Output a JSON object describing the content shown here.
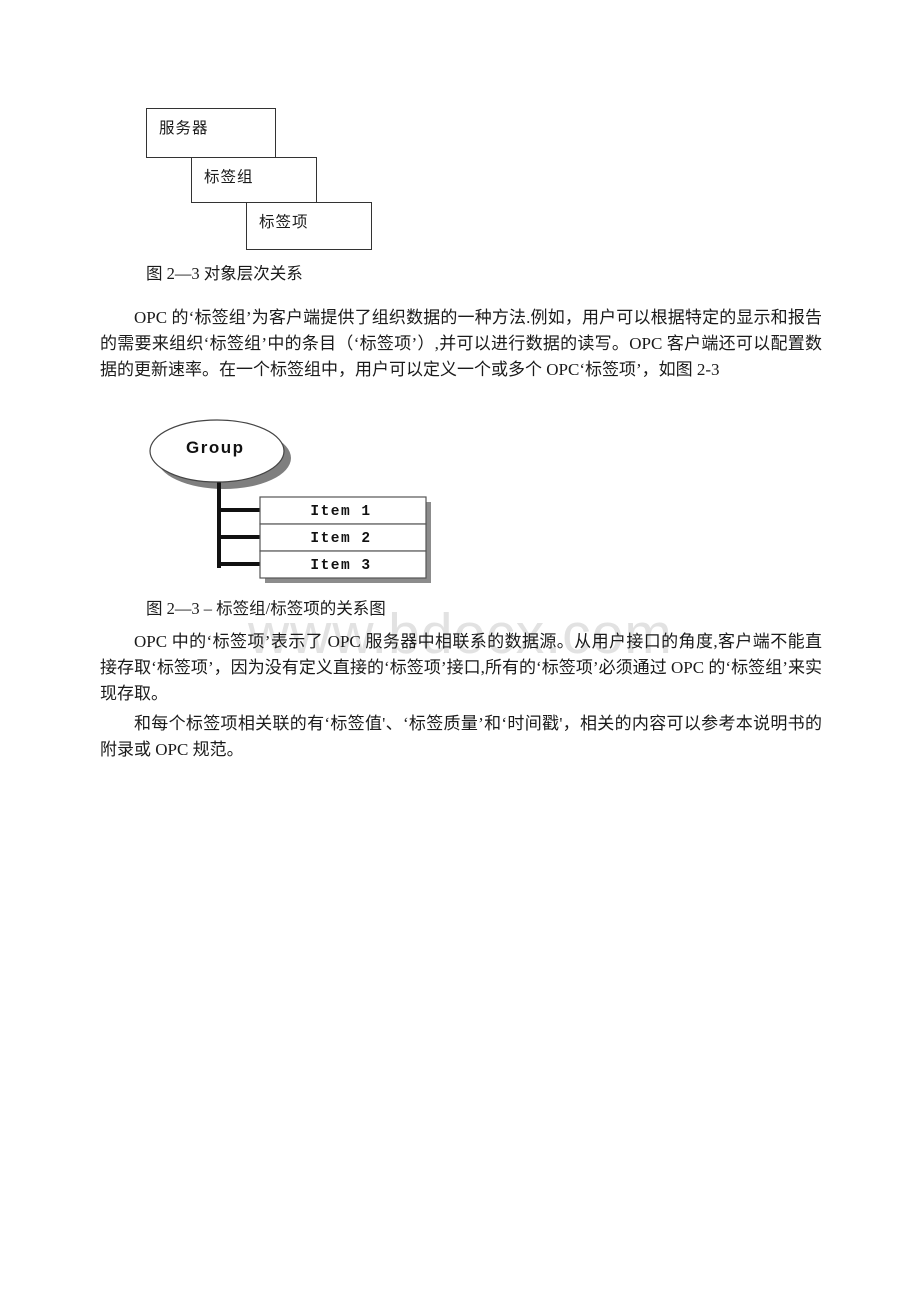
{
  "page": {
    "background": "#ffffff",
    "text_color": "#1a1a1a"
  },
  "watermark": {
    "text": "www.bdocx.com",
    "color": "#e2e2e2"
  },
  "diagram_hierarchy": {
    "name": "object-hierarchy-diagram",
    "boxes": [
      {
        "label": "服务器"
      },
      {
        "label": "标签组"
      },
      {
        "label": "标签项"
      }
    ],
    "caption": "图 2—3 对象层次关系"
  },
  "diagram_group_item": {
    "name": "group-item-relationship-diagram",
    "group_label": "Group",
    "items": [
      {
        "label": "Item 1"
      },
      {
        "label": "Item 2"
      },
      {
        "label": "Item 3"
      }
    ],
    "caption": "图 2—3 – 标签组/标签项的关系图",
    "shadow_color": "#7f7f7f",
    "line_color": "#111111"
  },
  "paragraphs": {
    "p1": "OPC 的‘标签组’为客户端提供了组织数据的一种方法.例如，用户可以根据特定的显示和报告的需要来组织‘标签组’中的条目（‘标签项’）,并可以进行数据的读写。OPC 客户端还可以配置数据的更新速率。在一个标签组中，用户可以定义一个或多个 OPC‘标签项’，如图 2-3",
    "p2": "OPC 中的‘标签项’表示了 OPC 服务器中相联系的数据源。从用户接口的角度,客户端不能直接存取‘标签项’，因为没有定义直接的‘标签项’接口,所有的‘标签项’必须通过 OPC 的‘标签组’来实现存取。",
    "p3": "和每个标签项相关联的有‘标签值'、‘标签质量’和‘时间戳'，相关的内容可以参考本说明书的附录或 OPC 规范。"
  }
}
